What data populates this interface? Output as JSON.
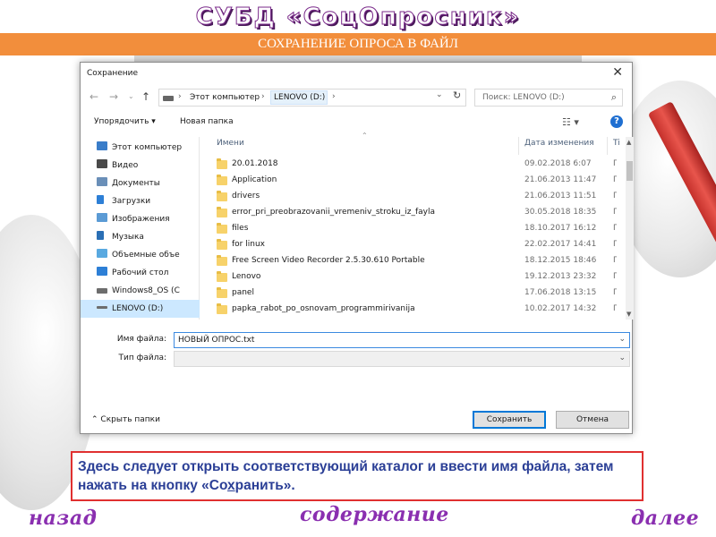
{
  "slide": {
    "title": "СУБД «СоцОпросник»",
    "banner": "СОХРАНЕНИЕ ОПРОСА В ФАЙЛ",
    "note_part1": "Здесь следует открыть соответствующий каталог и ввести имя файла, затем нажать на кнопку «Со",
    "note_underlined": "х",
    "note_part2": "ранить».",
    "nav_back": "назад",
    "nav_contents": "содержание",
    "nav_next": "далее"
  },
  "dialog": {
    "title": "Сохранение",
    "address": [
      "Этот компьютер",
      "LENOVO (D:)"
    ],
    "search_placeholder": "Поиск: LENOVO (D:)",
    "toolbar": {
      "organize": "Упорядочить ▾",
      "new_folder": "Новая папка"
    },
    "nav_items": [
      {
        "label": "Этот компьютер",
        "icon": "computer-icon",
        "color": "#3a7dc9"
      },
      {
        "label": "Видео",
        "icon": "video-icon",
        "color": "#4a4a4a"
      },
      {
        "label": "Документы",
        "icon": "documents-icon",
        "color": "#6a8fb8"
      },
      {
        "label": "Загрузки",
        "icon": "downloads-icon",
        "color": "#2d7fd6"
      },
      {
        "label": "Изображения",
        "icon": "pictures-icon",
        "color": "#5b9bd5"
      },
      {
        "label": "Музыка",
        "icon": "music-icon",
        "color": "#2a6fb5"
      },
      {
        "label": "Объемные объе",
        "icon": "3d-objects-icon",
        "color": "#59a9e0"
      },
      {
        "label": "Рабочий стол",
        "icon": "desktop-icon",
        "color": "#2d7fd6"
      },
      {
        "label": "Windows8_OS (C",
        "icon": "drive-icon",
        "color": "#6d6d6d"
      },
      {
        "label": "LENOVO (D:)",
        "icon": "drive-icon",
        "color": "#6d6d6d"
      }
    ],
    "columns": {
      "name": "Имени",
      "date": "Дата изменения",
      "type": "Ti"
    },
    "files": [
      {
        "name": "20.01.2018",
        "date": "09.02.2018 6:07",
        "type": "П"
      },
      {
        "name": "Application",
        "date": "21.06.2013 11:47",
        "type": "П"
      },
      {
        "name": "drivers",
        "date": "21.06.2013 11:51",
        "type": "П"
      },
      {
        "name": "error_pri_preobrazovanii_vremeniv_stroku_iz_fayla",
        "date": "30.05.2018 18:35",
        "type": "П"
      },
      {
        "name": "files",
        "date": "18.10.2017 16:12",
        "type": "П"
      },
      {
        "name": "for linux",
        "date": "22.02.2017 14:41",
        "type": "П"
      },
      {
        "name": "Free Screen Video Recorder 2.5.30.610 Portable",
        "date": "18.12.2015 18:46",
        "type": "П"
      },
      {
        "name": "Lenovo",
        "date": "19.12.2013 23:32",
        "type": "П"
      },
      {
        "name": "panel",
        "date": "17.06.2018 13:15",
        "type": "П"
      },
      {
        "name": "papka_rabot_po_osnovam_programmirivanija",
        "date": "10.02.2017 14:32",
        "type": "П"
      }
    ],
    "filename_label": "Имя файла:",
    "filename_value": "НОВЫЙ ОПРОС.txt",
    "filetype_label": "Тип файла:",
    "filetype_value": "",
    "hide_folders": "Скрыть папки",
    "save_button": "Сохранить",
    "cancel_button": "Отмена"
  }
}
